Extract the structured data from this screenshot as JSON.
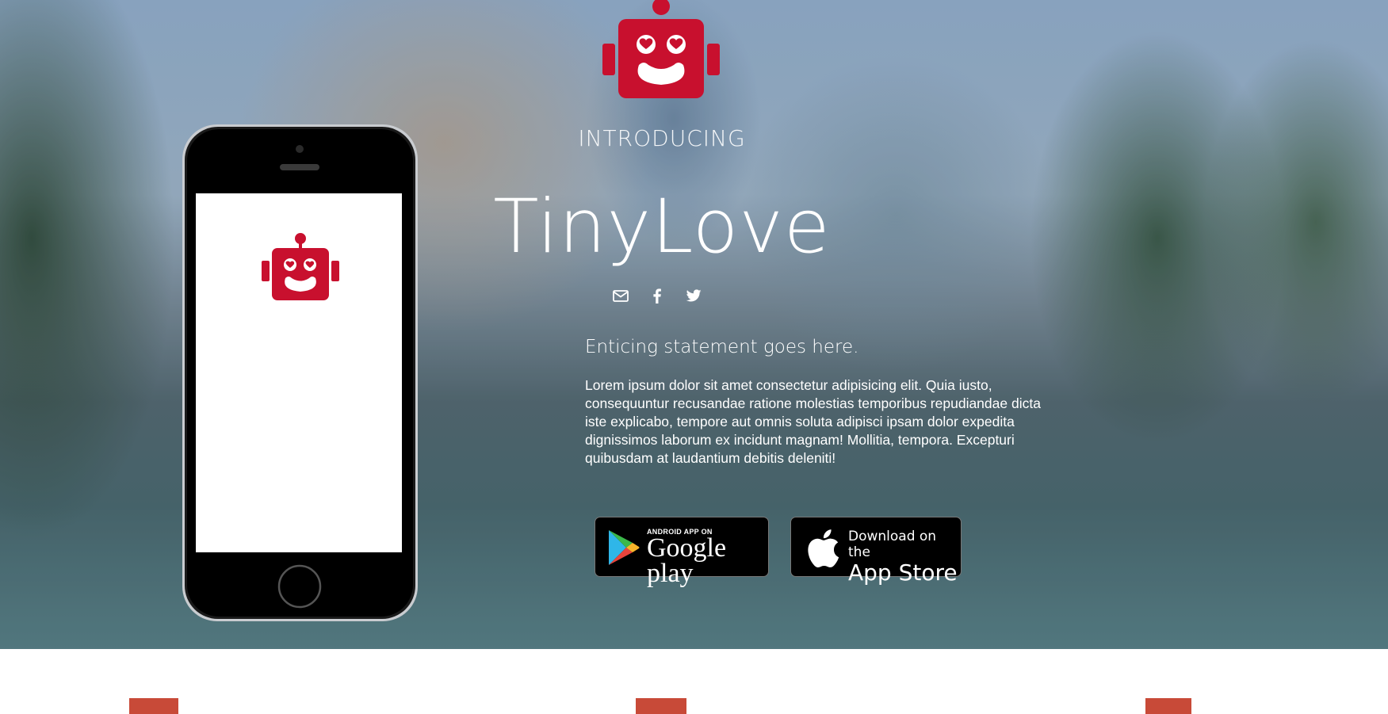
{
  "hero": {
    "introducing": "INTRODUCING",
    "title": "TinyLove",
    "tagline": "Enticing statement goes here.",
    "body": "Lorem ipsum dolor sit amet consectetur adipisicing elit. Quia iusto, consequuntur recusandae ratione molestias temporibus repudiandae dicta iste explicabo, tempore aut omnis soluta adipisci ipsam dolor expedita dignissimos laborum ex incidunt magnam! Mollitia, tempora. Excepturi quibusdam at laudantium debitis deleniti!"
  },
  "social": [
    {
      "icon": "email-icon"
    },
    {
      "icon": "facebook-icon"
    },
    {
      "icon": "twitter-icon"
    }
  ],
  "stores": {
    "google": {
      "small": "ANDROID APP ON",
      "big": "Google play"
    },
    "apple": {
      "small": "Download on the",
      "big": "App Store"
    }
  },
  "colors": {
    "brand_red": "#c8102e",
    "feature_accent": "#c84a38"
  }
}
